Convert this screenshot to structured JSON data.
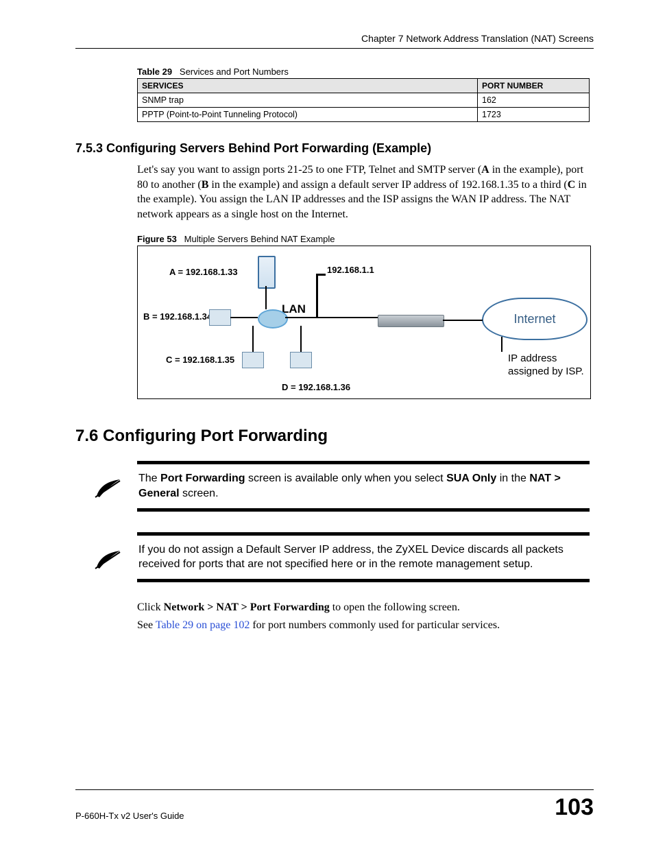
{
  "header": {
    "chapter": "Chapter 7 Network Address Translation (NAT) Screens"
  },
  "table": {
    "caption_label": "Table 29",
    "caption_text": "Services and Port Numbers",
    "cols": {
      "services": "SERVICES",
      "port": "PORT NUMBER"
    },
    "rows": [
      {
        "service": "SNMP trap",
        "port": "162"
      },
      {
        "service": "PPTP (Point-to-Point Tunneling Protocol)",
        "port": "1723"
      }
    ]
  },
  "sec753": {
    "heading": "7.5.3  Configuring Servers Behind Port Forwarding (Example)",
    "para_parts": [
      "Let's say you want to assign ports 21-25 to one FTP, Telnet and SMTP server (",
      "A",
      " in the example), port 80 to another (",
      "B",
      " in the example) and assign a default server IP address of 192.168.1.35 to a third (",
      "C",
      " in the example). You assign the LAN IP addresses and the ISP assigns the WAN IP address. The NAT network appears as a single host on the Internet."
    ]
  },
  "figure53": {
    "caption_label": "Figure 53",
    "caption_text": "Multiple Servers Behind NAT Example",
    "labels": {
      "a": "A = 192.168.1.33",
      "b": "B = 192.168.1.34",
      "c": "C  = 192.168.1.35",
      "d": "D = 192.168.1.36",
      "gateway_ip": "192.168.1.1",
      "lan": "LAN",
      "internet": "Internet",
      "isp": "IP address assigned by ISP."
    }
  },
  "sec76": {
    "heading": "7.6  Configuring Port Forwarding"
  },
  "note1": {
    "parts": [
      "The ",
      "Port Forwarding",
      " screen is available only when you select ",
      "SUA Only",
      " in the ",
      "NAT > General",
      " screen."
    ]
  },
  "note2": {
    "text": "If you do not assign a Default Server IP address, the ZyXEL Device discards all packets received for ports that are not specified here or in the remote management setup."
  },
  "click_line": {
    "pre": "Click ",
    "path": "Network > NAT > Port Forwarding",
    "post": " to open the following screen."
  },
  "see_line": {
    "pre": "See ",
    "link": "Table 29 on page 102",
    "post": " for port numbers commonly used for particular services."
  },
  "footer": {
    "guide": "P-660H-Tx v2 User's Guide",
    "page": "103"
  }
}
